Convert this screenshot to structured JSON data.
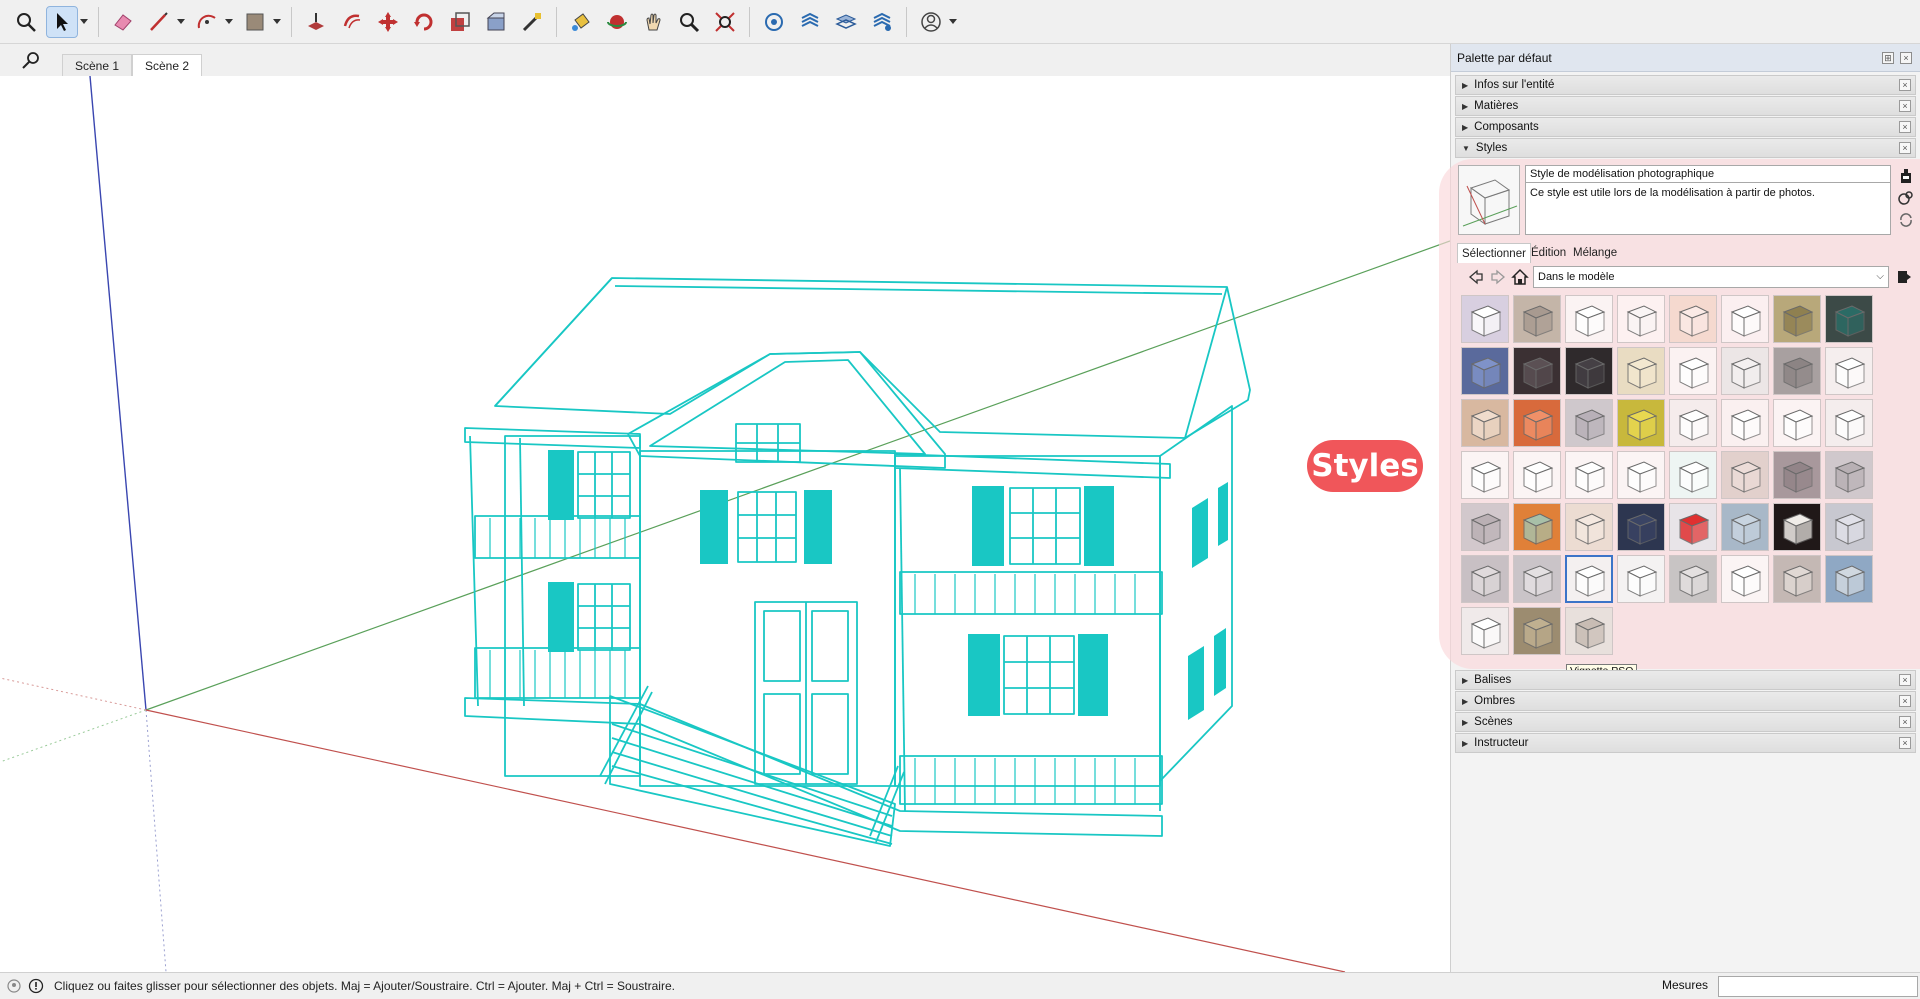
{
  "toolbar": {
    "tools": [
      {
        "name": "zoom-window-icon",
        "dropdown": false
      },
      {
        "name": "select-icon",
        "dropdown": true,
        "active": true
      },
      {
        "name": "eraser-icon",
        "dropdown": false
      },
      {
        "name": "pencil-line-icon",
        "dropdown": true
      },
      {
        "name": "arc-icon",
        "dropdown": true
      },
      {
        "name": "rectangle-icon",
        "dropdown": true
      },
      {
        "name": "push-pull-icon",
        "dropdown": false
      },
      {
        "name": "offset-icon",
        "dropdown": false
      },
      {
        "name": "move-icon",
        "dropdown": false
      },
      {
        "name": "rotate-icon",
        "dropdown": false
      },
      {
        "name": "scale-icon",
        "dropdown": false
      },
      {
        "name": "follow-me-icon",
        "dropdown": false
      },
      {
        "name": "tape-measure-icon",
        "dropdown": false
      },
      {
        "name": "paint-bucket-icon",
        "dropdown": false
      },
      {
        "name": "orbit-icon",
        "dropdown": false
      },
      {
        "name": "pan-icon",
        "dropdown": false
      },
      {
        "name": "zoom-icon",
        "dropdown": false
      },
      {
        "name": "zoom-extents-icon",
        "dropdown": false
      },
      {
        "name": "warehouse-icon",
        "dropdown": false
      },
      {
        "name": "extension-warehouse-icon",
        "dropdown": false
      },
      {
        "name": "layers-icon",
        "dropdown": false
      },
      {
        "name": "extension-manager-icon",
        "dropdown": false
      },
      {
        "name": "account-icon",
        "dropdown": true
      }
    ]
  },
  "scenes": {
    "tabs": [
      "Scène 1",
      "Scène 2"
    ],
    "active": 1
  },
  "callout": {
    "label": "Styles",
    "color": "#f0565a"
  },
  "tray": {
    "title": "Palette par défaut",
    "panels_top": [
      "Infos sur l'entité",
      "Matières",
      "Composants",
      "Styles"
    ],
    "panels_bottom": [
      "Balises",
      "Ombres",
      "Scènes",
      "Instructeur"
    ],
    "styles": {
      "name": "Style de modélisation photographique",
      "description": "Ce style est utile lors de la modélisation à partir de photos.",
      "subtabs": [
        "Sélectionner",
        "Édition",
        "Mélange"
      ],
      "active_subtab": 0,
      "collection": "Dans le modèle",
      "tooltip": "Vignette PSO",
      "selected_swatch": 42,
      "swatches": [
        {
          "bg": "#d8cfe0",
          "fg": "#ffffff"
        },
        {
          "bg": "#c4b5a8",
          "fg": "#a89a90"
        },
        {
          "bg": "#fbf3f3",
          "fg": "#ffffff"
        },
        {
          "bg": "#fdf1f1",
          "fg": "#faf5f5"
        },
        {
          "bg": "#f5d9cf",
          "fg": "#fbeae6"
        },
        {
          "bg": "#fbeff0",
          "fg": "#ffffff"
        },
        {
          "bg": "#b8a87a",
          "fg": "#8f8050"
        },
        {
          "bg": "#3c4a47",
          "fg": "#2b6b65"
        },
        {
          "bg": "#5a6a9c",
          "fg": "#7f92c8"
        },
        {
          "bg": "#3b3033",
          "fg": "#5b5054"
        },
        {
          "bg": "#2f2a2c",
          "fg": "#454045"
        },
        {
          "bg": "#e9dcc2",
          "fg": "#f3e8d0"
        },
        {
          "bg": "#fbf2f2",
          "fg": "#ffffff"
        },
        {
          "bg": "#ece6e6",
          "fg": "#f4f0f0"
        },
        {
          "bg": "#a8a0a0",
          "fg": "#8c8484"
        },
        {
          "bg": "#f5eeee",
          "fg": "#ffffff"
        },
        {
          "bg": "#d8b8a0",
          "fg": "#f0dccc"
        },
        {
          "bg": "#d86a3c",
          "fg": "#f09068"
        },
        {
          "bg": "#cfc8cc",
          "fg": "#b8b0b8"
        },
        {
          "bg": "#c8b83c",
          "fg": "#e8d850"
        },
        {
          "bg": "#f5ecec",
          "fg": "#ffffff"
        },
        {
          "bg": "#faf0f0",
          "fg": "#ffffff"
        },
        {
          "bg": "#fbf3f3",
          "fg": "#ffffff"
        },
        {
          "bg": "#f4eded",
          "fg": "#ffffff"
        },
        {
          "bg": "#fbf4f4",
          "fg": "#ffffff"
        },
        {
          "bg": "#fbf4f4",
          "fg": "#ffffff"
        },
        {
          "bg": "#fbf4f4",
          "fg": "#ffffff"
        },
        {
          "bg": "#fbf4f4",
          "fg": "#ffffff"
        },
        {
          "bg": "#eef5f3",
          "fg": "#ffffff"
        },
        {
          "bg": "#e2d0cc",
          "fg": "#ecdcd8"
        },
        {
          "bg": "#a8989c",
          "fg": "#928488"
        },
        {
          "bg": "#d0c8cc",
          "fg": "#b8b0b4"
        },
        {
          "bg": "#d2c8cc",
          "fg": "#bab0b4"
        },
        {
          "bg": "#e08038",
          "fg": "#a8c0a8"
        },
        {
          "bg": "#ecdcd2",
          "fg": "#f4e8e0"
        },
        {
          "bg": "#2d3650",
          "fg": "#3a4464"
        },
        {
          "bg": "#e8e4e8",
          "fg": "#e03030"
        },
        {
          "bg": "#a8b8c8",
          "fg": "#c8d4e0"
        },
        {
          "bg": "#201818",
          "fg": "#f0ece8"
        },
        {
          "bg": "#c8c8d0",
          "fg": "#e0e0e8"
        },
        {
          "bg": "#c8c0c4",
          "fg": "#e0dadc"
        },
        {
          "bg": "#cac4c8",
          "fg": "#e4e0e2"
        },
        {
          "bg": "#f4f0f0",
          "fg": "#ffffff"
        },
        {
          "bg": "#f4f2f2",
          "fg": "#ffffff"
        },
        {
          "bg": "#c8c4c4",
          "fg": "#e4e0e0"
        },
        {
          "bg": "#fbf4f4",
          "fg": "#ffffff"
        },
        {
          "bg": "#c4b8b4",
          "fg": "#e0d8d4"
        },
        {
          "bg": "#8fa8c4",
          "fg": "#d0d8e0"
        },
        {
          "bg": "#f0eaea",
          "fg": "#ffffff"
        },
        {
          "bg": "#9c8c70",
          "fg": "#c0b090"
        },
        {
          "bg": "#e8e0dc",
          "fg": "#c8bcb4"
        }
      ]
    }
  },
  "status": {
    "text": "Cliquez ou faites glisser pour sélectionner des objets. Maj = Ajouter/Soustraire. Ctrl = Ajouter. Maj + Ctrl = Soustraire.",
    "measure_label": "Mesures",
    "measure_value": ""
  },
  "colors": {
    "model_lines": "#19c7c4",
    "axis_red": "#c0504d",
    "axis_green": "#5aa05a",
    "axis_blue": "#3a46b0"
  }
}
